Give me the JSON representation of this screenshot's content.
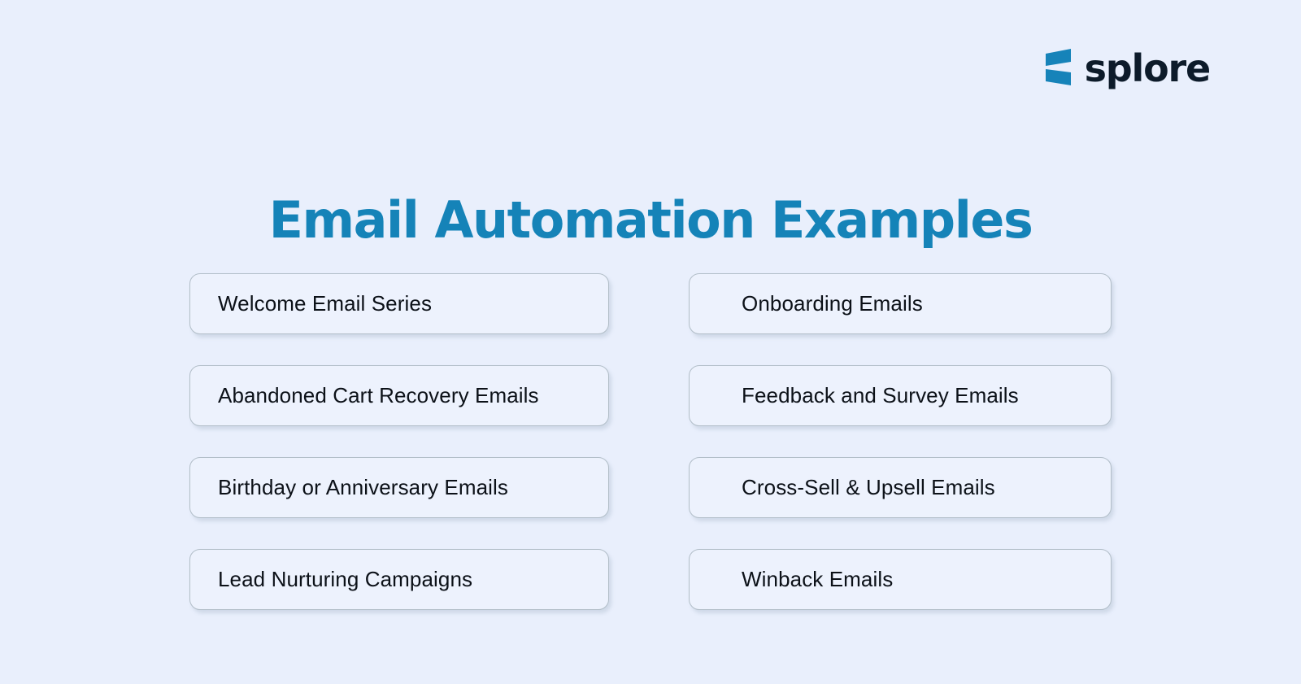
{
  "page": {
    "background_color": "#e9effc",
    "accent_color": "#1583b8"
  },
  "brand": {
    "logo_icon": "splore-logo-mark",
    "name": "splore",
    "mark_color": "#1683b9",
    "wordmark_color": "#0d1b2a"
  },
  "heading": {
    "title": "Email Automation Examples",
    "color": "#1583b8"
  },
  "cards": {
    "left_column": [
      {
        "label": "Welcome Email Series"
      },
      {
        "label": "Abandoned Cart Recovery Emails"
      },
      {
        "label": "Birthday or Anniversary Emails"
      },
      {
        "label": "Lead Nurturing Campaigns"
      }
    ],
    "right_column": [
      {
        "label": "Onboarding Emails"
      },
      {
        "label": "Feedback and Survey Emails"
      },
      {
        "label": "Cross-Sell & Upsell Emails"
      },
      {
        "label": "Winback Emails"
      }
    ],
    "style": {
      "background_color": "#edf2fd",
      "border_color": "#b2bec8",
      "text_color": "#0c1118"
    }
  }
}
